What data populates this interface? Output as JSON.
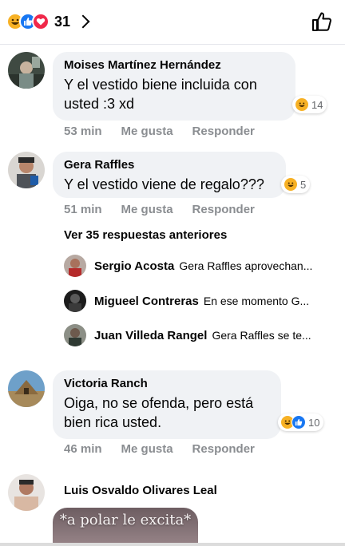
{
  "header": {
    "reaction_count": "31",
    "reactions": [
      "haha-emoji",
      "like-emoji",
      "love-emoji"
    ]
  },
  "comments": [
    {
      "author": "Moises Martínez Hernández",
      "text": "Y el vestido biene incluida con usted :3 xd",
      "time": "53 min",
      "like": "Me gusta",
      "reply": "Responder",
      "reaction_count": "14"
    },
    {
      "author": "Gera Raffles",
      "text": "Y el vestido viene de regalo???",
      "time": "51 min",
      "like": "Me gusta",
      "reply": "Responder",
      "reaction_count": "5"
    },
    {
      "author": "Victoria Ranch",
      "text": "Oiga, no se ofenda, pero está bien rica usted.",
      "time": "46 min",
      "like": "Me gusta",
      "reply": "Responder",
      "reaction_count": "10"
    },
    {
      "author": "Luis Osvaldo Olivares Leal",
      "photo_text": "*a polar le excita*"
    }
  ],
  "more_replies": "Ver 35 respuestas anteriores",
  "replies": [
    {
      "author": "Sergio Acosta",
      "text": "Gera Raffles aprovechan..."
    },
    {
      "author": "Migueel Contreras",
      "text": "En ese momento G..."
    },
    {
      "author": "Juan Villeda Rangel",
      "text": "Gera Raffles se te..."
    }
  ],
  "colors": {
    "bubble": "#f0f2f5",
    "meta": "#8a8d91",
    "like_blue": "#1877f2",
    "love_red": "#f0284a",
    "haha_yellow": "#f7b125"
  }
}
